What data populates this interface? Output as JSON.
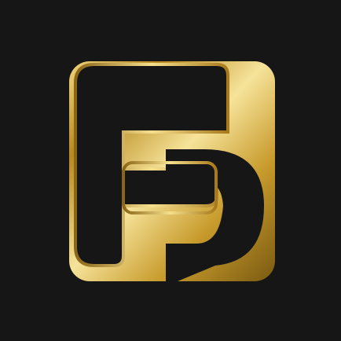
{
  "app": {
    "icon_name": "fp-monogram-logo-icon",
    "colors": {
      "background": "#161616",
      "gold_dark": "#7a5a12",
      "gold_mid": "#c9a33a",
      "gold_light": "#f6e39a",
      "letter_fill": "#161616"
    }
  }
}
